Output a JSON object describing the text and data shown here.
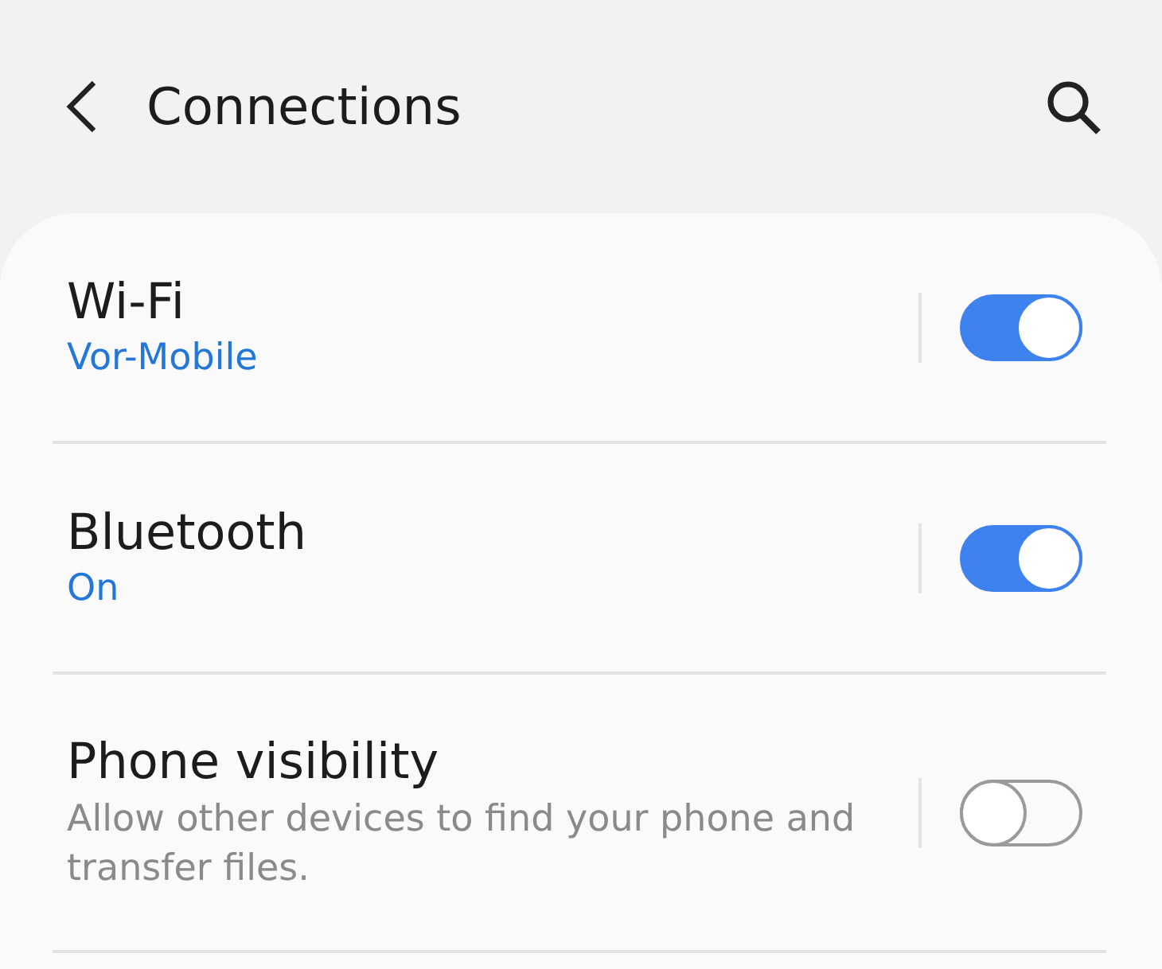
{
  "header": {
    "title": "Connections"
  },
  "rows": [
    {
      "title": "Wi-Fi",
      "subtitle": "Vor-Mobile",
      "kind": "status",
      "on": true
    },
    {
      "title": "Bluetooth",
      "subtitle": "On",
      "kind": "status",
      "on": true
    },
    {
      "title": "Phone visibility",
      "subtitle": "Allow other devices to find your phone and transfer files.",
      "kind": "description",
      "on": false
    }
  ]
}
